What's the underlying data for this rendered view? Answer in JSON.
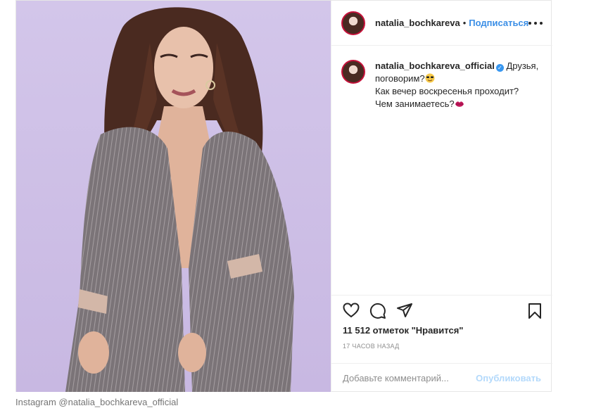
{
  "header": {
    "username": "natalia_bochkareva",
    "separator": "•",
    "follow_label": "Подписаться"
  },
  "caption": {
    "username": "natalia_bochkareva_official",
    "verified_mark": "✓",
    "line1": "Друзья, поговорим?",
    "line2": "Как вечер воскресенья проходит?",
    "line3": "Чем занимаетесь?"
  },
  "actions": {
    "likes_text": "11 512 отметок \"Нравится\"",
    "time_text": "17 ЧАСОВ НАЗАД"
  },
  "comment": {
    "placeholder": "Добавьте комментарий...",
    "publish_label": "Опубликовать"
  },
  "credit": "Instagram @natalia_bochkareva_official",
  "colors": {
    "link_blue": "#3a8ee6",
    "publish_disabled": "#b3d9fb",
    "background_lilac": "#cdbfe6"
  },
  "icons": [
    "heart-icon",
    "comment-icon",
    "share-icon",
    "bookmark-icon",
    "more-icon",
    "verified-icon"
  ]
}
